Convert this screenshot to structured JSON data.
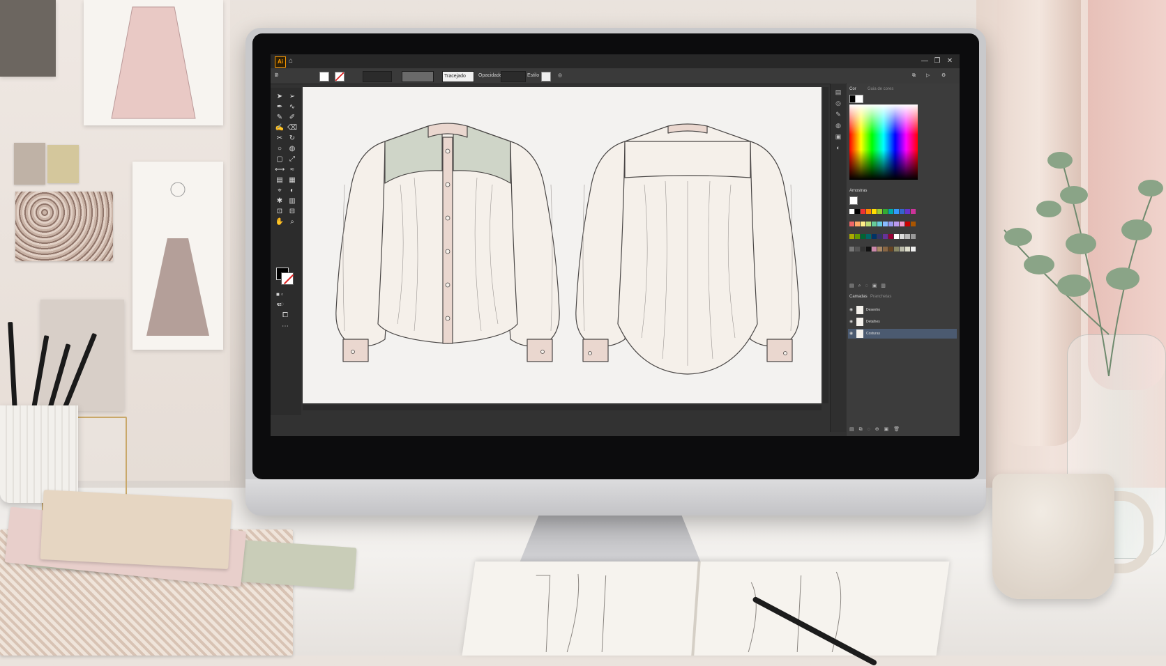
{
  "app": {
    "logo_text": "Ai",
    "window_controls": [
      "—",
      "❐",
      "✕"
    ]
  },
  "control_bar": {
    "items": [
      "Tracejado",
      "Estilo",
      "Opacidade"
    ],
    "stroke_label": "Tracejado",
    "opacity_label": "Opacidade",
    "style_label": "Estilo"
  },
  "panels": {
    "color": {
      "tab": "Cor",
      "sub": "Guia de cores"
    },
    "swatches": {
      "tab": "Amostras"
    },
    "layers": {
      "tab": "Camadas",
      "sub": "Pranchetas",
      "items": [
        {
          "name": "Desenho",
          "selected": false
        },
        {
          "name": "Detalhes",
          "selected": false
        },
        {
          "name": "Costuras",
          "selected": true
        }
      ]
    }
  },
  "artwork": {
    "subject": "blouse technical flat",
    "colors": {
      "fabric": "#f5f0ea",
      "collar": "#ead7cf",
      "yoke": "#cfd5c8",
      "outline": "#4a4746"
    }
  },
  "swatch_colors": [
    "#ffffff",
    "#000000",
    "#e33",
    "#f80",
    "#fd0",
    "#9c3",
    "#3a3",
    "#0aa",
    "#39f",
    "#36c",
    "#63c",
    "#c39",
    "#e66",
    "#fa6",
    "#fe8",
    "#bd7",
    "#6c9",
    "#6cd",
    "#8bf",
    "#99e",
    "#b9e",
    "#e9c",
    "#c00",
    "#a50",
    "#aa0",
    "#690",
    "#063",
    "#066",
    "#036",
    "#336",
    "#639",
    "#903",
    "#fff",
    "#ddd",
    "#bbb",
    "#999",
    "#777",
    "#555",
    "#333",
    "#111",
    "#c8a",
    "#a86",
    "#864",
    "#642",
    "#886",
    "#bba",
    "#ddc",
    "#eee"
  ],
  "accent": "#ff9a00"
}
